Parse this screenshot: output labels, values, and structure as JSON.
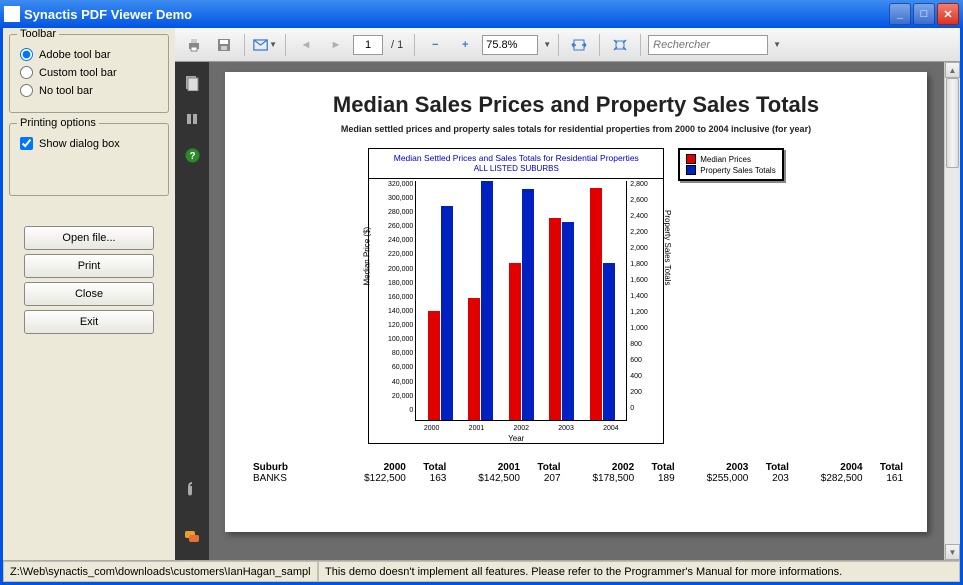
{
  "window": {
    "title": "Synactis PDF Viewer Demo"
  },
  "left_panel": {
    "toolbar_group": {
      "title": "Toolbar",
      "options": [
        "Adobe tool bar",
        "Custom tool bar",
        "No tool bar"
      ],
      "selected": 0
    },
    "printing_group": {
      "title": "Printing options",
      "show_dialog_label": "Show dialog box",
      "show_dialog_checked": true
    },
    "buttons": {
      "open": "Open file...",
      "print": "Print",
      "close": "Close",
      "exit": "Exit"
    }
  },
  "toolbar": {
    "page_current": "1",
    "page_total": "/  1",
    "zoom": "75.8%",
    "search_placeholder": "Rechercher"
  },
  "document": {
    "title": "Median Sales Prices and Property Sales Totals",
    "subtitle": "Median settled prices and property sales totals for residential properties from 2000 to 2004 inclusive (for year)",
    "chart_title_line1": "Median Settled Prices and Sales Totals for Residential Properties",
    "chart_title_line2": "ALL LISTED SUBURBS",
    "legend": {
      "a": "Median Prices",
      "b": "Property Sales Totals"
    }
  },
  "chart_data": {
    "type": "bar",
    "categories": [
      "2000",
      "2001",
      "2002",
      "2003",
      "2004"
    ],
    "series": [
      {
        "name": "Median Prices",
        "axis": "left",
        "values": [
          145000,
          163000,
          210000,
          270000,
          310000
        ]
      },
      {
        "name": "Property Sales Totals",
        "axis": "right",
        "values": [
          2600,
          2900,
          2800,
          2400,
          1900
        ]
      }
    ],
    "title": "Median Settled Prices and Sales Totals for Residential Properties — ALL LISTED SUBURBS",
    "xlabel": "Year",
    "ylabel_left": "Median Price ($)",
    "ylabel_right": "Property Sales Totals",
    "ylim_left": [
      0,
      320000
    ],
    "ylim_right": [
      0,
      2900
    ],
    "yticks_left": [
      320000,
      300000,
      280000,
      260000,
      240000,
      220000,
      200000,
      180000,
      160000,
      140000,
      120000,
      100000,
      80000,
      60000,
      40000,
      20000,
      0
    ],
    "yticks_right": [
      2800,
      2600,
      2400,
      2200,
      2000,
      1800,
      1600,
      1400,
      1200,
      1000,
      800,
      600,
      400,
      200,
      0
    ]
  },
  "table": {
    "headers": {
      "suburb": "Suburb",
      "y2000": "2000",
      "t2000": "Total",
      "y2001": "2001",
      "t2001": "Total",
      "y2002": "2002",
      "t2002": "Total",
      "y2003": "2003",
      "t2003": "Total",
      "y2004": "2004",
      "t2004": "Total"
    },
    "rows": [
      {
        "suburb": "BANKS",
        "y2000": "$122,500",
        "t2000": "163",
        "y2001": "$142,500",
        "t2001": "207",
        "y2002": "$178,500",
        "t2002": "189",
        "y2003": "$255,000",
        "t2003": "203",
        "y2004": "$282,500",
        "t2004": "161"
      }
    ]
  },
  "statusbar": {
    "path": "Z:\\Web\\synactis_com\\downloads\\customers\\IanHagan_sampl",
    "message": "This demo doesn't implement all features. Please refer to the Programmer's Manual for more informations."
  }
}
